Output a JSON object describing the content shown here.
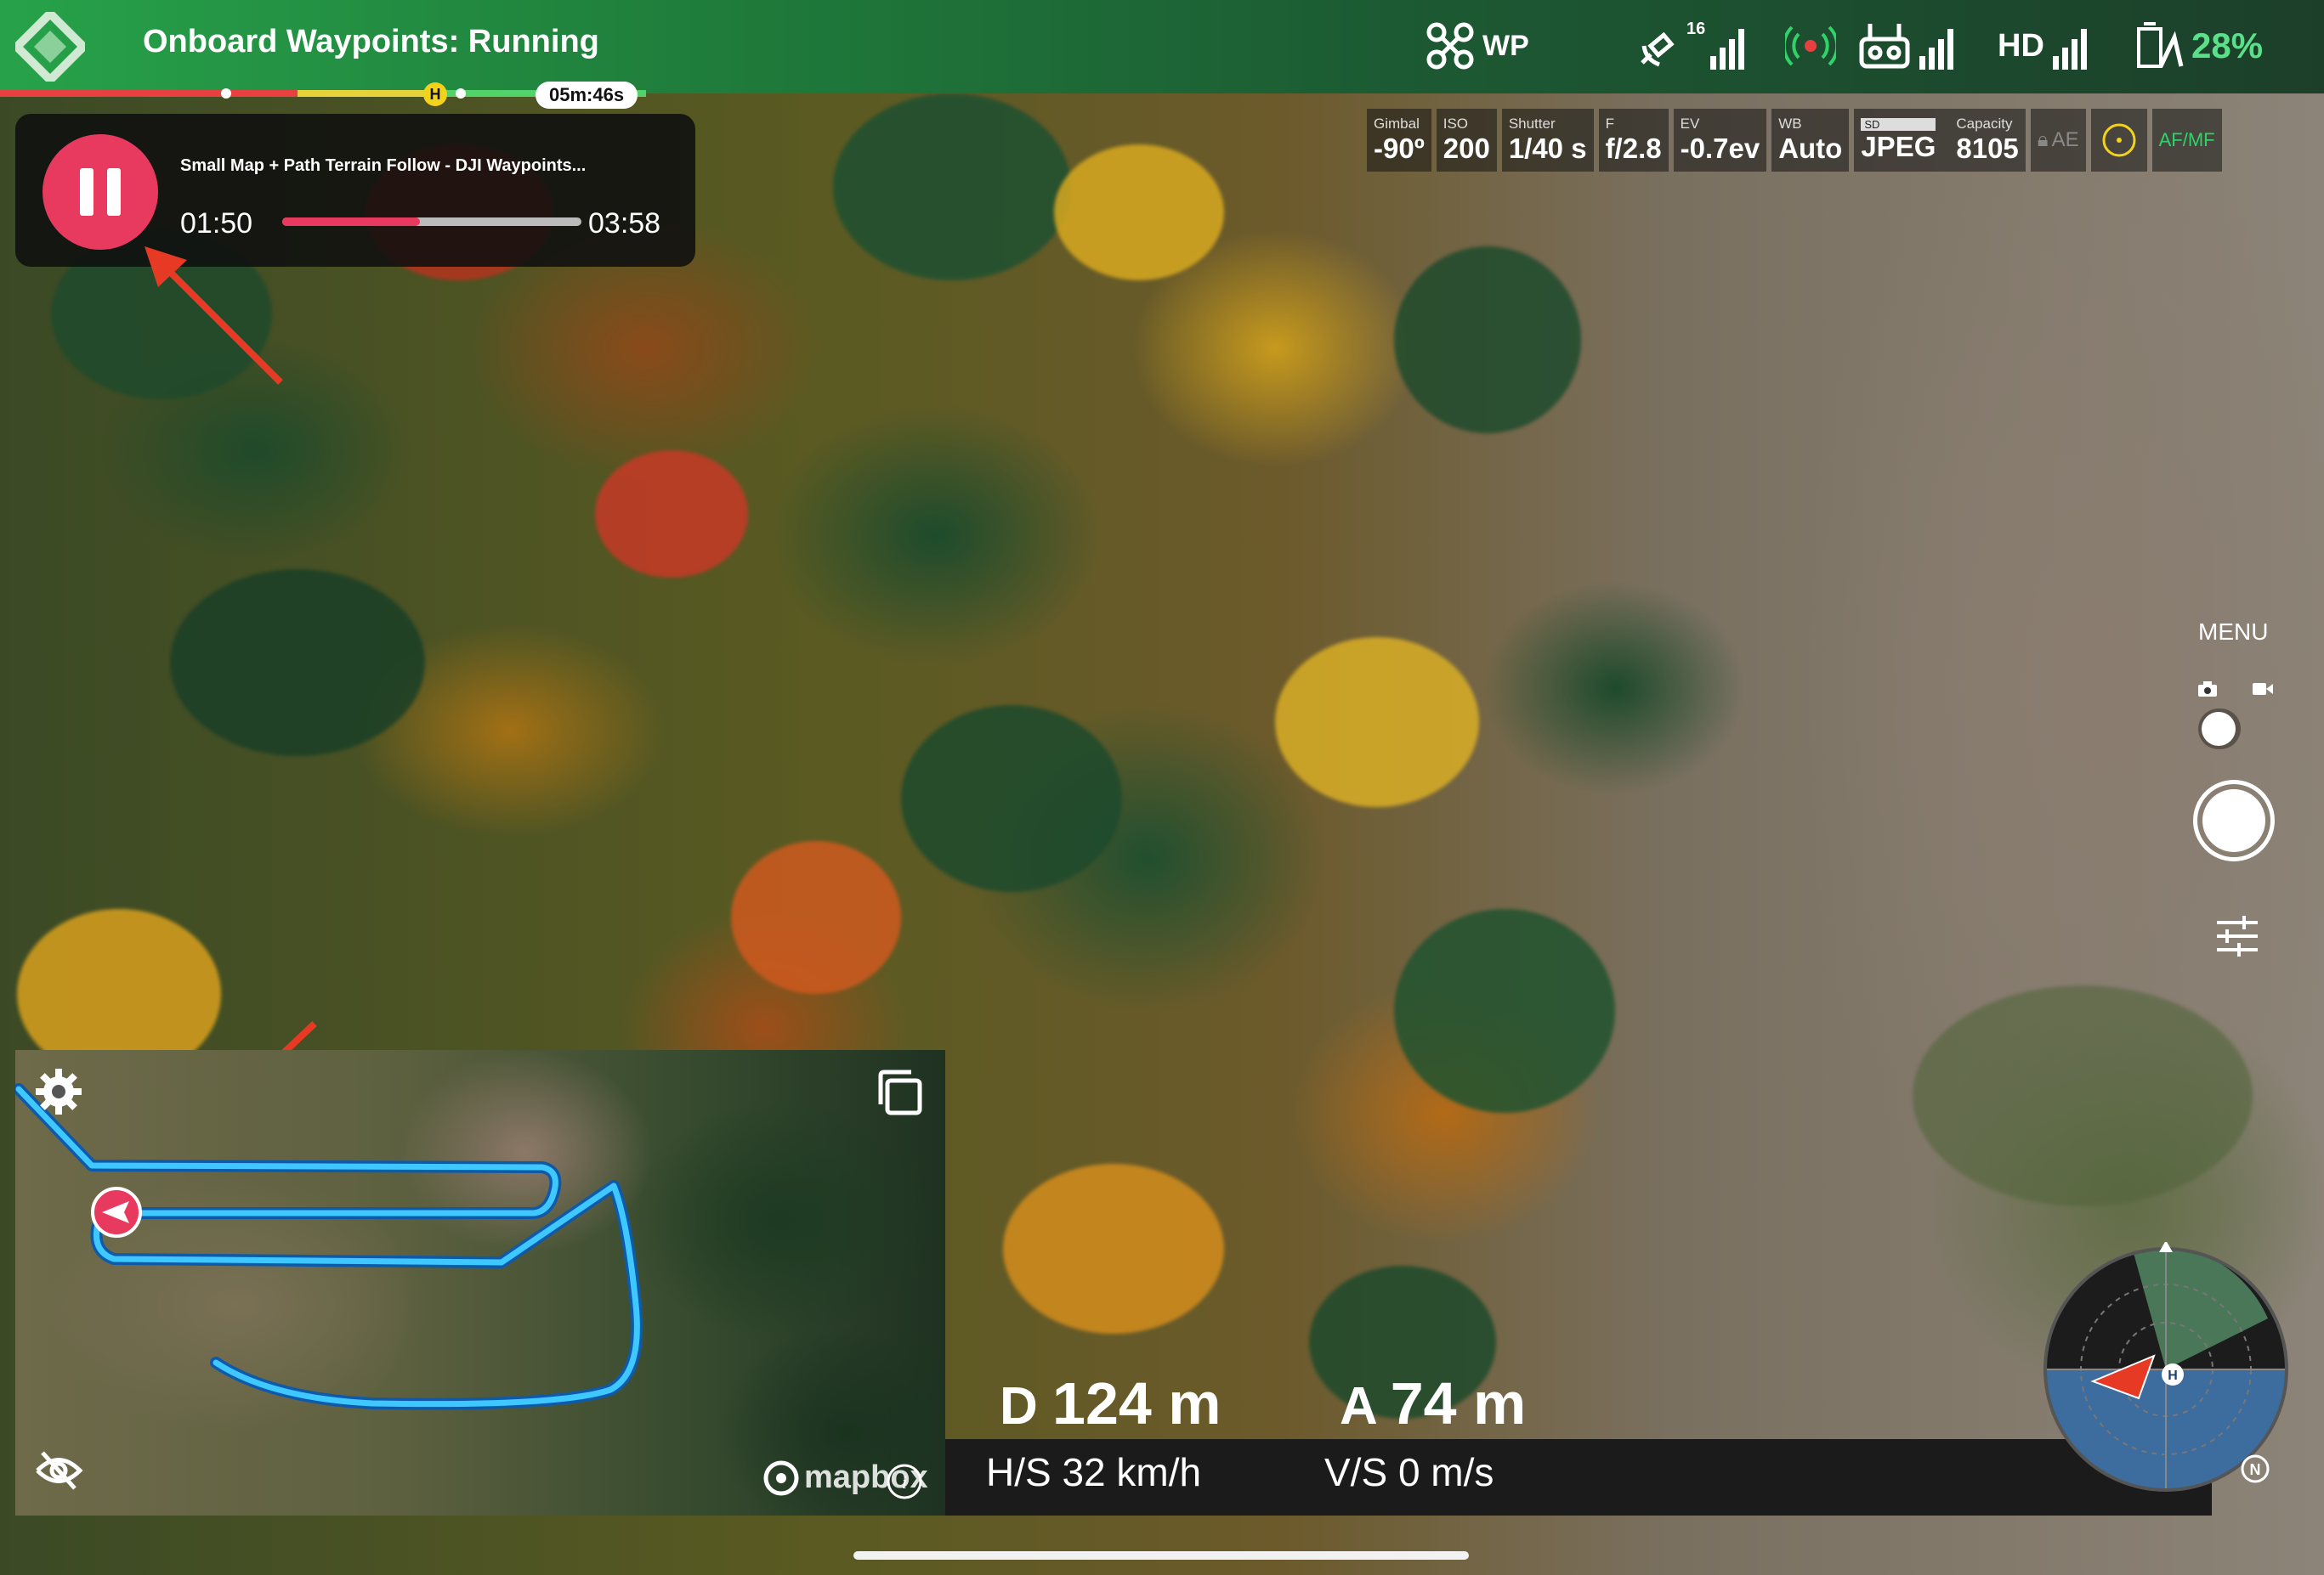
{
  "header": {
    "status_title": "Onboard Waypoints: Running",
    "mission_eta": "05m:46s",
    "home_marker": "H",
    "mode": {
      "icon": "drone-icon",
      "label": "WP"
    },
    "gps": {
      "icon": "satellite-icon",
      "count": "16"
    },
    "rtk": {
      "icon": "rtk-signal-icon"
    },
    "remote": {
      "icon": "remote-controller-icon"
    },
    "video": {
      "label": "HD"
    },
    "battery": {
      "icon": "battery-icon",
      "percent": "28%"
    },
    "accent_green": "#27a24a"
  },
  "camera": {
    "gimbal": {
      "label": "Gimbal",
      "value": "-90º"
    },
    "iso": {
      "label": "ISO",
      "value": "200"
    },
    "shutter": {
      "label": "Shutter",
      "value": "1/40 s"
    },
    "aperture": {
      "label": "F",
      "value": "f/2.8"
    },
    "ev": {
      "label": "EV",
      "value": "-0.7ev"
    },
    "wb": {
      "label": "WB",
      "value": "Auto"
    },
    "format": {
      "label": "SD",
      "value": "JPEG"
    },
    "capacity": {
      "label": "Capacity",
      "value": "8105"
    },
    "ae": "AE",
    "af_mf": "AF/MF"
  },
  "mission": {
    "name": "Small Map + Path Terrain Follow - DJI Waypoints...",
    "elapsed": "01:50",
    "total": "03:58",
    "progress": 0.46,
    "pause_color": "#e83a5f"
  },
  "controls": {
    "menu_label": "MENU"
  },
  "minimap": {
    "attribution": "mapbox",
    "settings_icon": "gear-icon",
    "expand_icon": "expand-icon",
    "hide_icon": "eye-slash-icon",
    "path_color": "#2fb8ff"
  },
  "telemetry": {
    "distance_label": "D",
    "distance_value": "124 m",
    "altitude_label": "A",
    "altitude_value": "74 m",
    "hs_label": "H/S",
    "hs_value": "32 km/h",
    "vs_label": "V/S",
    "vs_value": "0 m/s"
  },
  "radar": {
    "home_marker": "H",
    "north_marker": "N"
  }
}
